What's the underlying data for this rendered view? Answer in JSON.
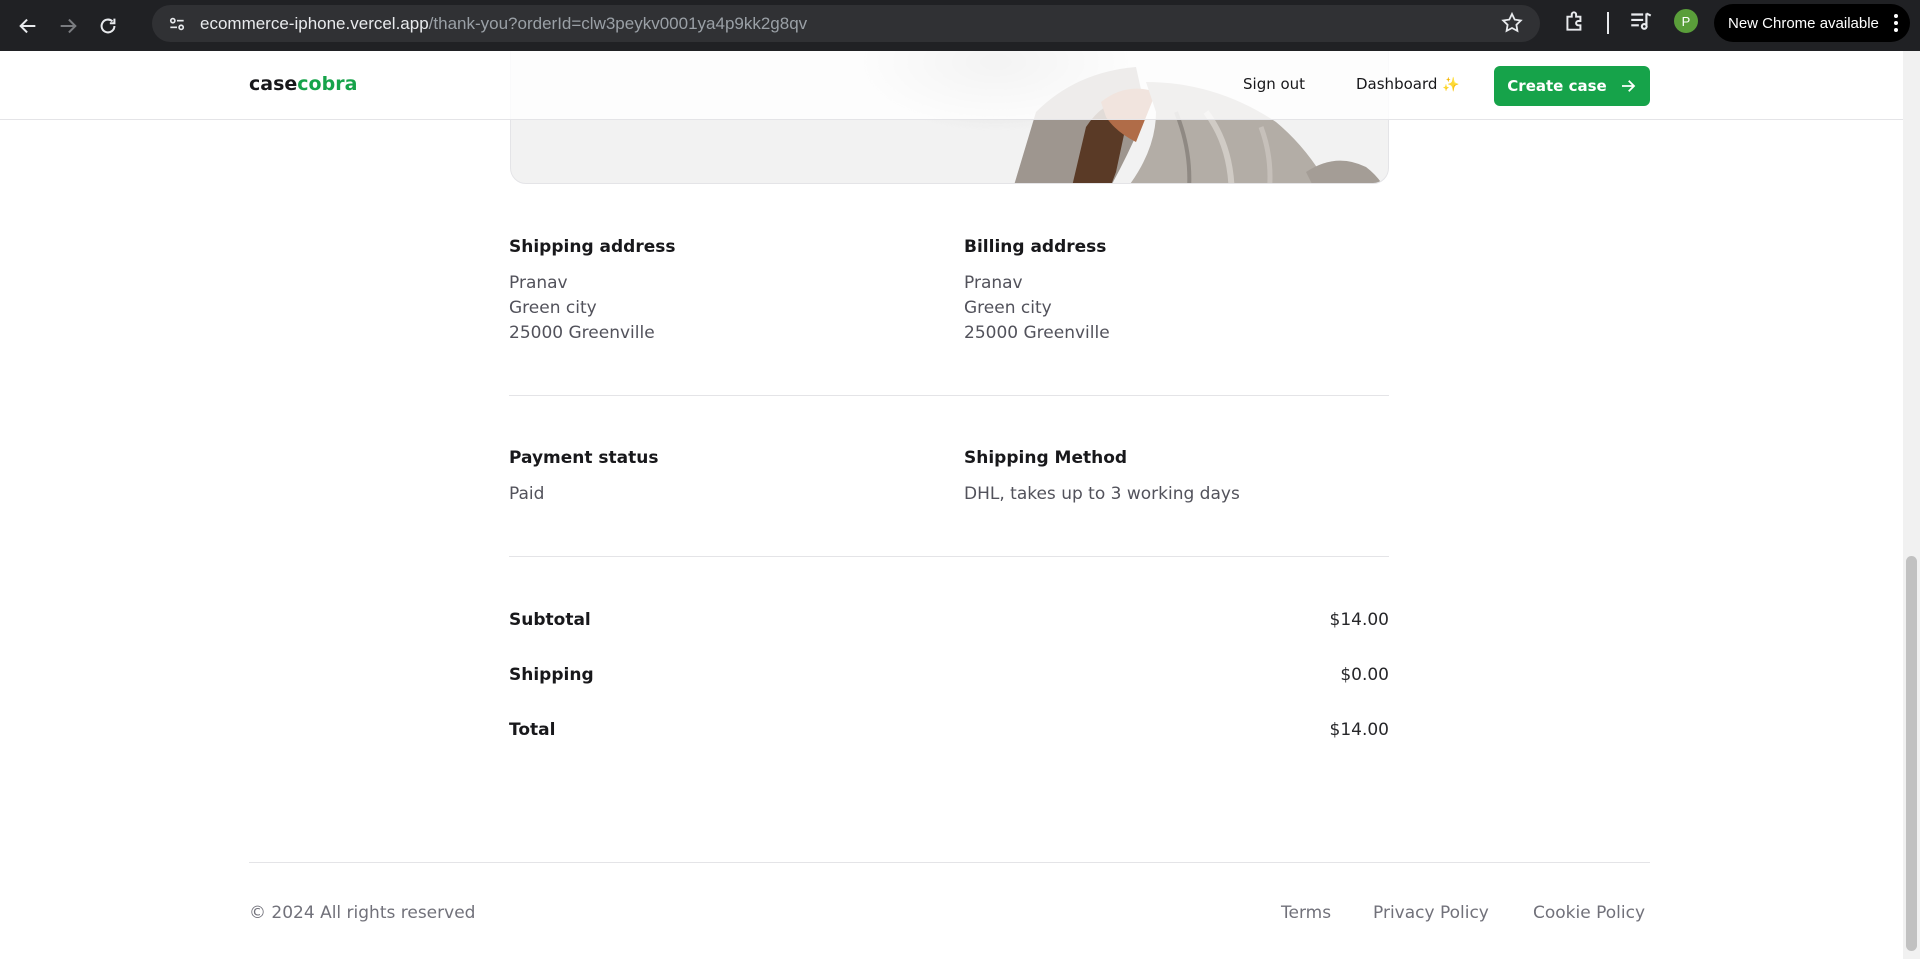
{
  "browser": {
    "url_host": "ecommerce-iphone.vercel.app",
    "url_path": "/thank-you?orderId=clw3peykv0001ya4p9kk2g8qv",
    "profile_initial": "P",
    "update_label": "New Chrome available"
  },
  "navbar": {
    "logo_part1": "case",
    "logo_part2": "cobra",
    "sign_out": "Sign out",
    "dashboard": "Dashboard",
    "dashboard_emoji": "✨",
    "create_case": "Create case"
  },
  "shipping": {
    "heading": "Shipping address",
    "name": "Pranav",
    "city": "Green city",
    "zip": "25000 Greenville"
  },
  "billing": {
    "heading": "Billing address",
    "name": "Pranav",
    "city": "Green city",
    "zip": "25000 Greenville"
  },
  "payment": {
    "heading": "Payment status",
    "value": "Paid"
  },
  "method": {
    "heading": "Shipping Method",
    "value": "DHL, takes up to 3 working days"
  },
  "summary": {
    "subtotal_label": "Subtotal",
    "subtotal_value": "$14.00",
    "shipping_label": "Shipping",
    "shipping_value": "$0.00",
    "total_label": "Total",
    "total_value": "$14.00"
  },
  "footer": {
    "copyright": "© 2024 All rights reserved",
    "terms": "Terms",
    "privacy": "Privacy Policy",
    "cookie": "Cookie Policy"
  },
  "colors": {
    "brand_green": "#16a34a",
    "chrome_dark": "#202124"
  }
}
